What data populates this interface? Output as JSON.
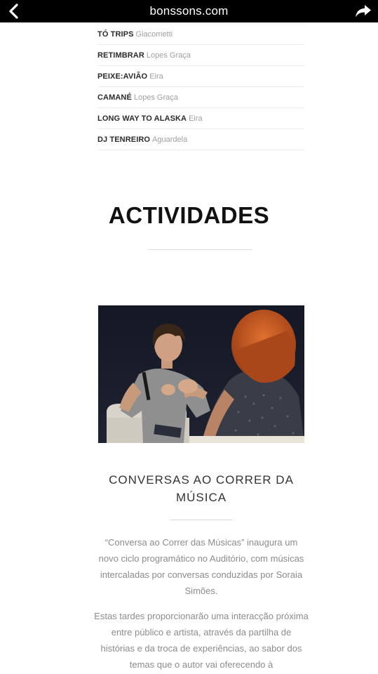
{
  "browser": {
    "title": "bonssons.com",
    "back_icon": "chevron-left-icon",
    "share_icon": "share-arrow-icon"
  },
  "lineup": [
    {
      "artist": "TÓ TRIPS",
      "stage": "Giacometti"
    },
    {
      "artist": "RETIMBRAR",
      "stage": "Lopes Graça"
    },
    {
      "artist": "PEIXE:AVIÃO",
      "stage": "Eira"
    },
    {
      "artist": "CAMANÉ",
      "stage": "Lopes Graça"
    },
    {
      "artist": "LONG WAY TO ALASKA",
      "stage": "Eira"
    },
    {
      "artist": "DJ TENREIRO",
      "stage": "Aguardela"
    }
  ],
  "section": {
    "title": "ACTIVIDADES"
  },
  "event": {
    "title": "CONVERSAS AO CORRER DA MÚSICA",
    "paragraphs": [
      "“Conversa ao Correr das Músicas” inaugura um novo ciclo programático no Auditório, com músicas intercaladas por conversas conduzidas por Soraia Simões.",
      "Estas tardes proporcionarão uma interacção próxima entre público e artista, através da partilha de histórias e da troca de experiências, ao sabor dos temas que o autor vai oferecendo à"
    ]
  },
  "colors": {
    "topbar_bg": "#000000",
    "text_dark": "#2b2b2b",
    "text_muted": "#a0a0a0"
  }
}
